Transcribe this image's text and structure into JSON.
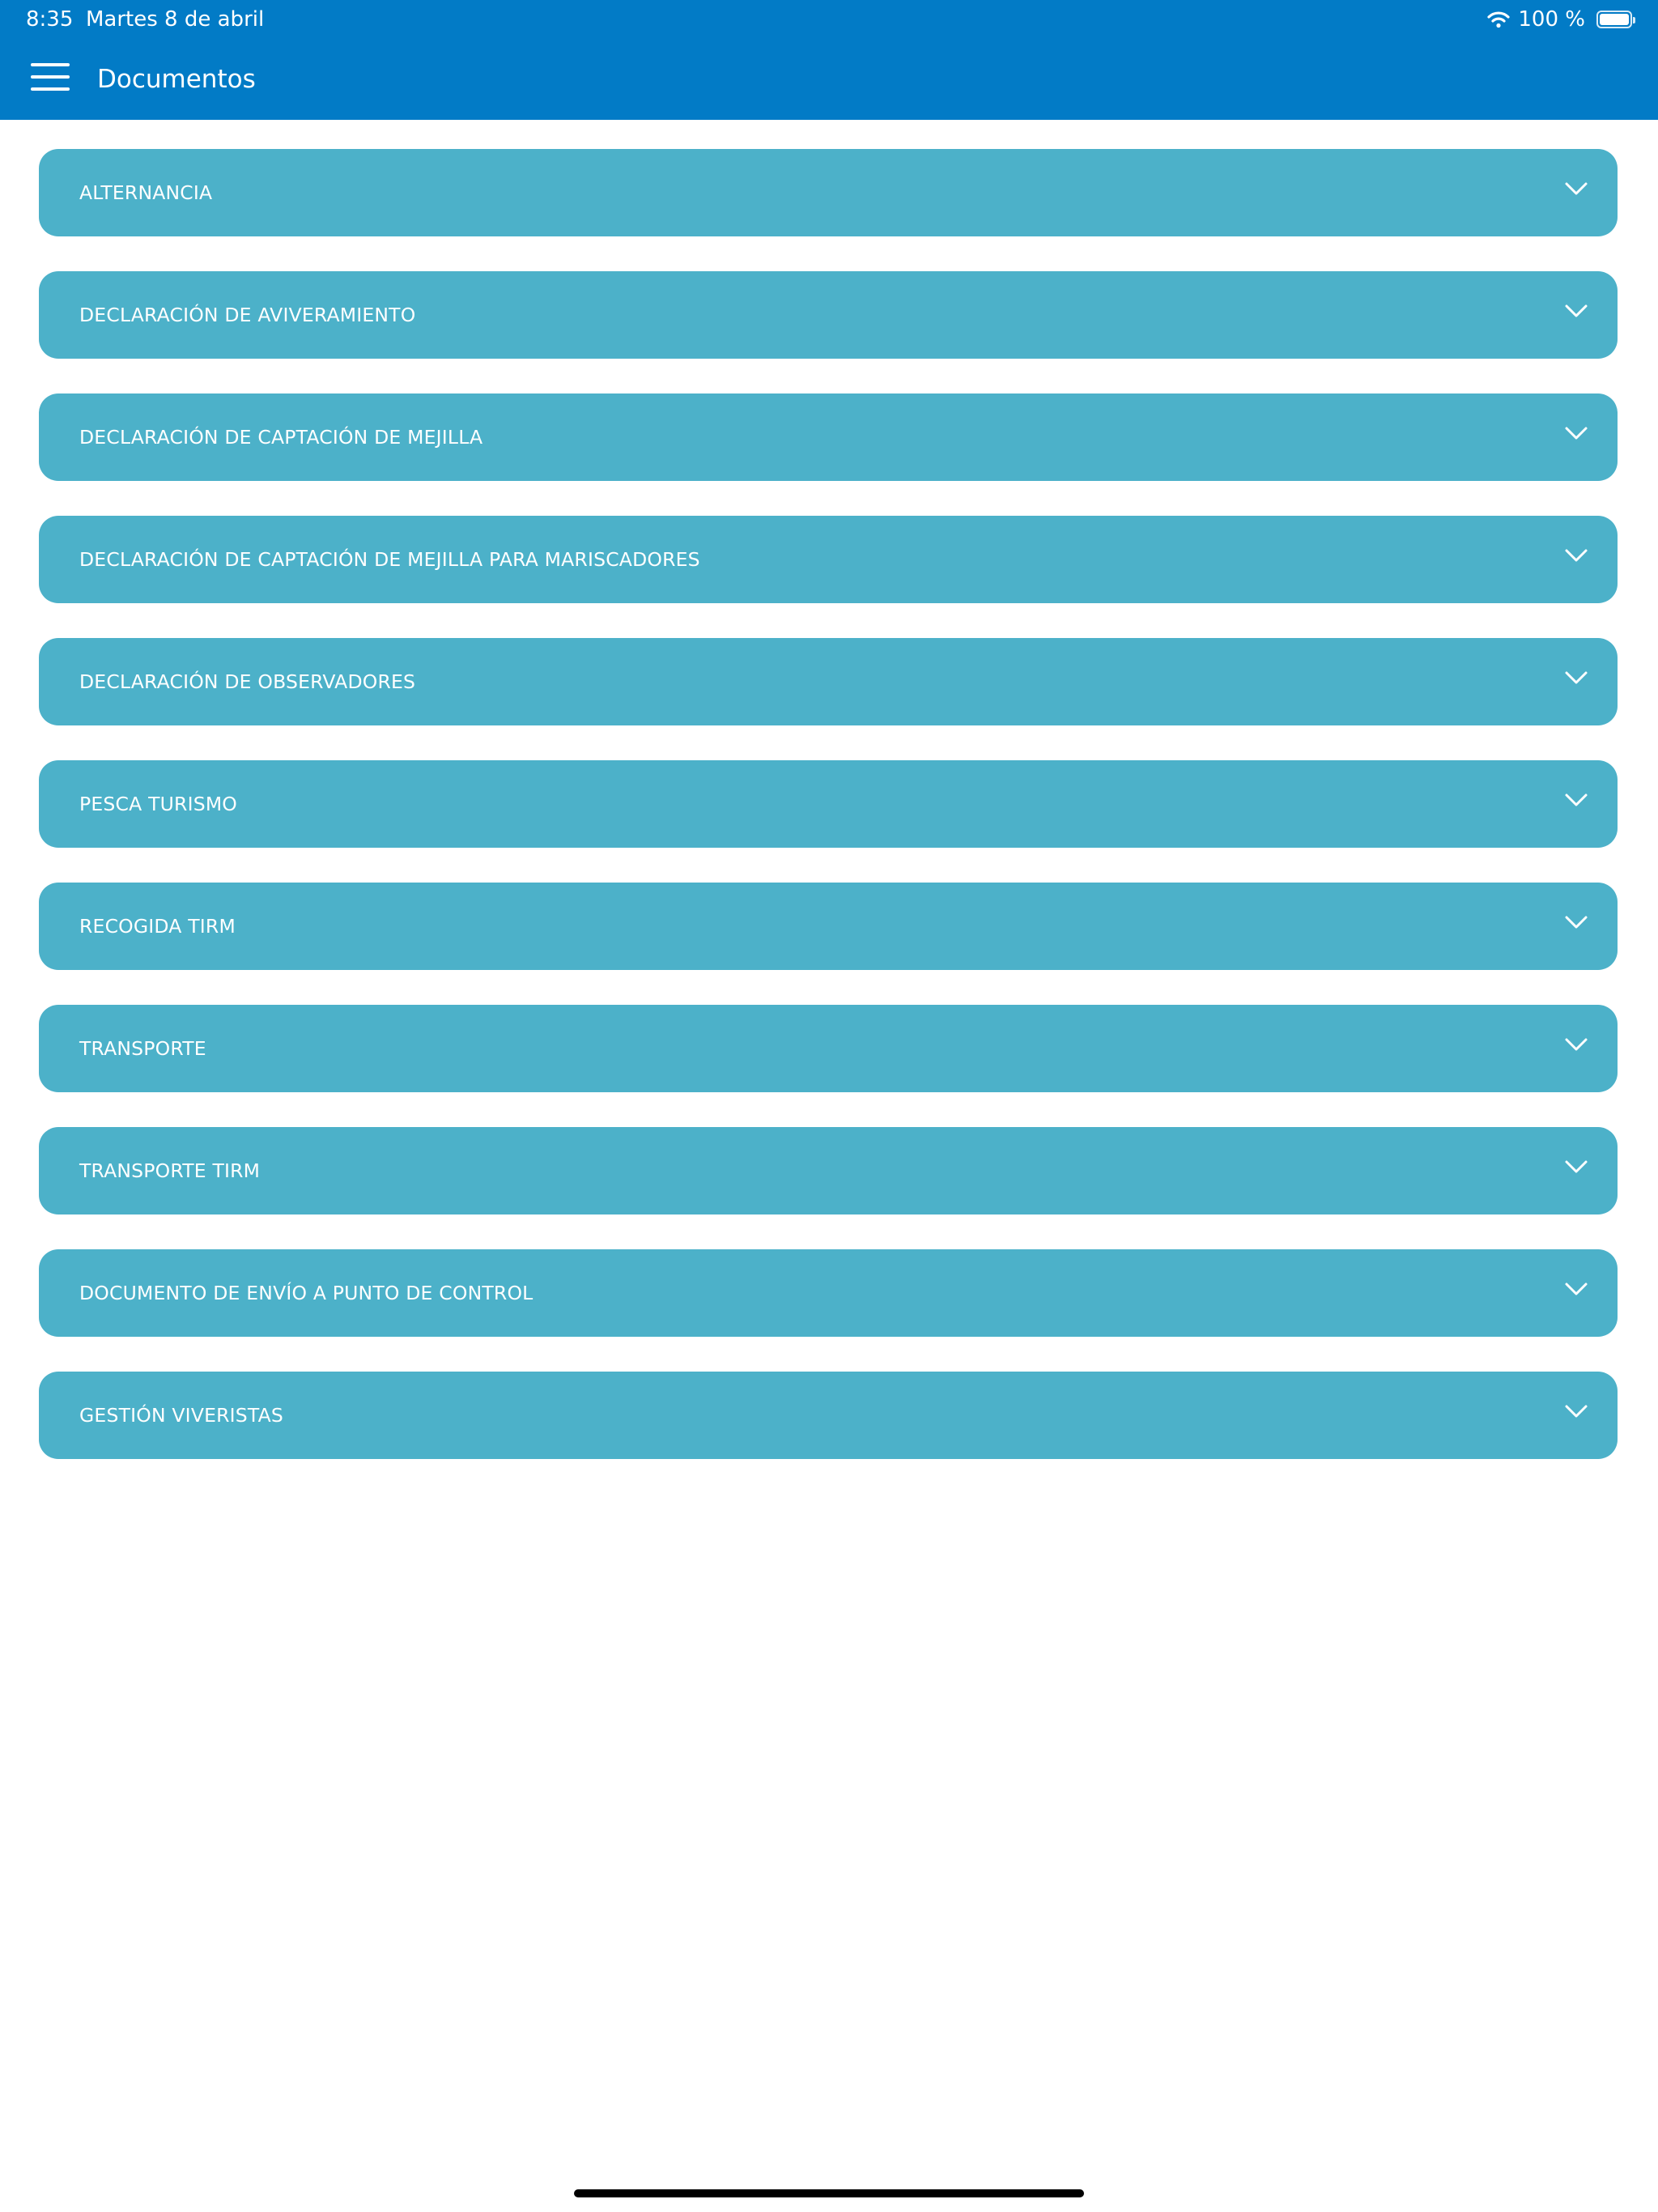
{
  "status_bar": {
    "time": "8:35",
    "date": "Martes 8 de abril",
    "battery": "100 %",
    "icons": [
      "wifi-icon",
      "battery-icon"
    ]
  },
  "header": {
    "menu_icon": "hamburger-menu-icon",
    "title": "Documentos"
  },
  "documents": [
    "ALTERNANCIA",
    "DECLARACIÓN DE AVIVERAMIENTO",
    "DECLARACIÓN DE CAPTACIÓN DE MEJILLA",
    "DECLARACIÓN DE CAPTACIÓN DE MEJILLA PARA MARISCADORES",
    "DECLARACIÓN DE OBSERVADORES",
    "PESCA TURISMO",
    "RECOGIDA TIRM",
    "TRANSPORTE",
    "TRANSPORTE TIRM",
    "DOCUMENTO DE ENVÍO A PUNTO DE CONTROL",
    "GESTIÓN VIVERISTAS"
  ],
  "item_icon": "chevron-down-icon",
  "colors": {
    "header": "#027bc6",
    "item_background": "#4cb1c9",
    "item_text": "#ffffff",
    "page_background": "#ffffff"
  }
}
